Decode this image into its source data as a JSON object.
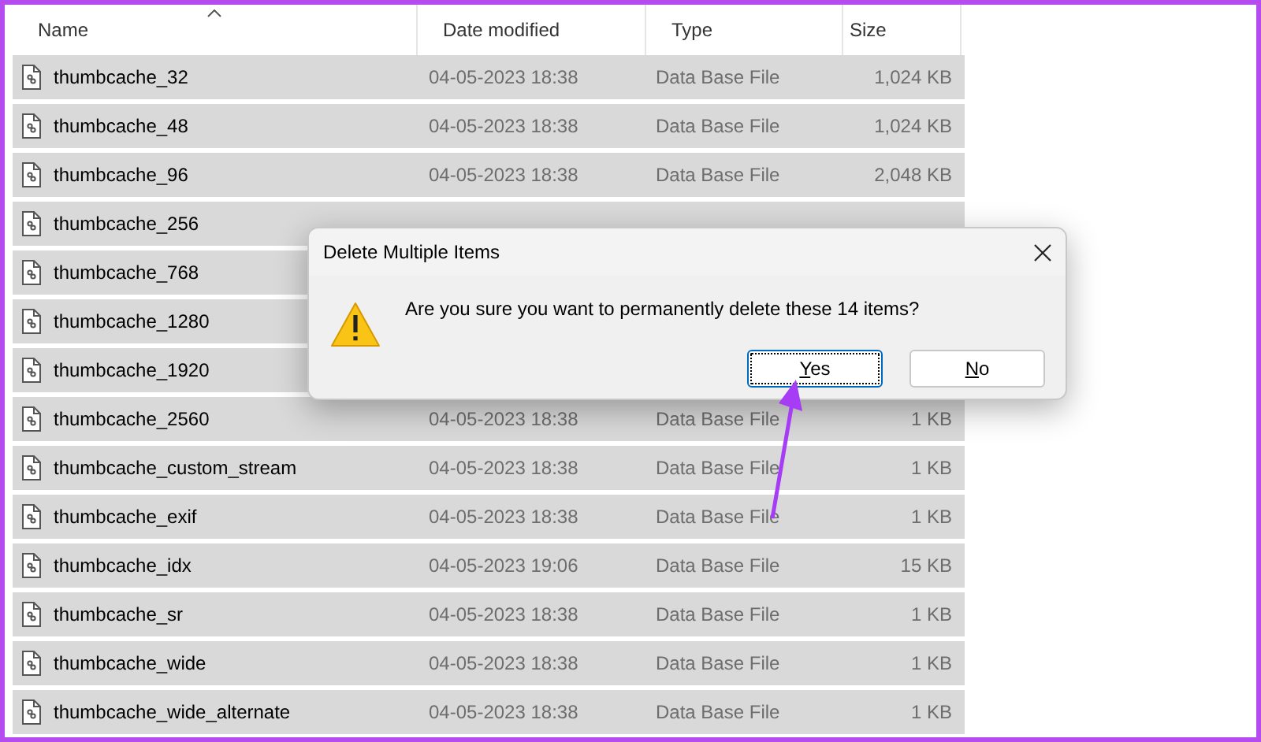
{
  "columns": [
    {
      "label": "Name",
      "sorted": true
    },
    {
      "label": "Date modified",
      "sorted": false
    },
    {
      "label": "Type",
      "sorted": false
    },
    {
      "label": "Size",
      "sorted": false
    }
  ],
  "rows": [
    {
      "name": "thumbcache_32",
      "date": "04-05-2023 18:38",
      "type": "Data Base File",
      "size": "1,024 KB",
      "selected": true
    },
    {
      "name": "thumbcache_48",
      "date": "04-05-2023 18:38",
      "type": "Data Base File",
      "size": "1,024 KB",
      "selected": true
    },
    {
      "name": "thumbcache_96",
      "date": "04-05-2023 18:38",
      "type": "Data Base File",
      "size": "2,048 KB",
      "selected": true
    },
    {
      "name": "thumbcache_256",
      "selected": true
    },
    {
      "name": "thumbcache_768",
      "selected": true
    },
    {
      "name": "thumbcache_1280",
      "selected": true
    },
    {
      "name": "thumbcache_1920",
      "selected": true
    },
    {
      "name": "thumbcache_2560",
      "date": "04-05-2023 18:38",
      "type": "Data Base File",
      "size": "1 KB",
      "selected": true
    },
    {
      "name": "thumbcache_custom_stream",
      "date": "04-05-2023 18:38",
      "type": "Data Base File",
      "size": "1 KB",
      "selected": true
    },
    {
      "name": "thumbcache_exif",
      "date": "04-05-2023 18:38",
      "type": "Data Base File",
      "size": "1 KB",
      "selected": true
    },
    {
      "name": "thumbcache_idx",
      "date": "04-05-2023 19:06",
      "type": "Data Base File",
      "size": "15 KB",
      "selected": true
    },
    {
      "name": "thumbcache_sr",
      "date": "04-05-2023 18:38",
      "type": "Data Base File",
      "size": "1 KB",
      "selected": true
    },
    {
      "name": "thumbcache_wide",
      "date": "04-05-2023 18:38",
      "type": "Data Base File",
      "size": "1 KB",
      "selected": true
    },
    {
      "name": "thumbcache_wide_alternate",
      "date": "04-05-2023 18:38",
      "type": "Data Base File",
      "size": "1 KB",
      "selected": true
    }
  ],
  "dialog": {
    "title": "Delete Multiple Items",
    "message": "Are you sure you want to permanently delete these 14 items?",
    "buttons": [
      {
        "label": "Yes",
        "focused": true
      },
      {
        "label": "No",
        "focused": false
      }
    ]
  }
}
